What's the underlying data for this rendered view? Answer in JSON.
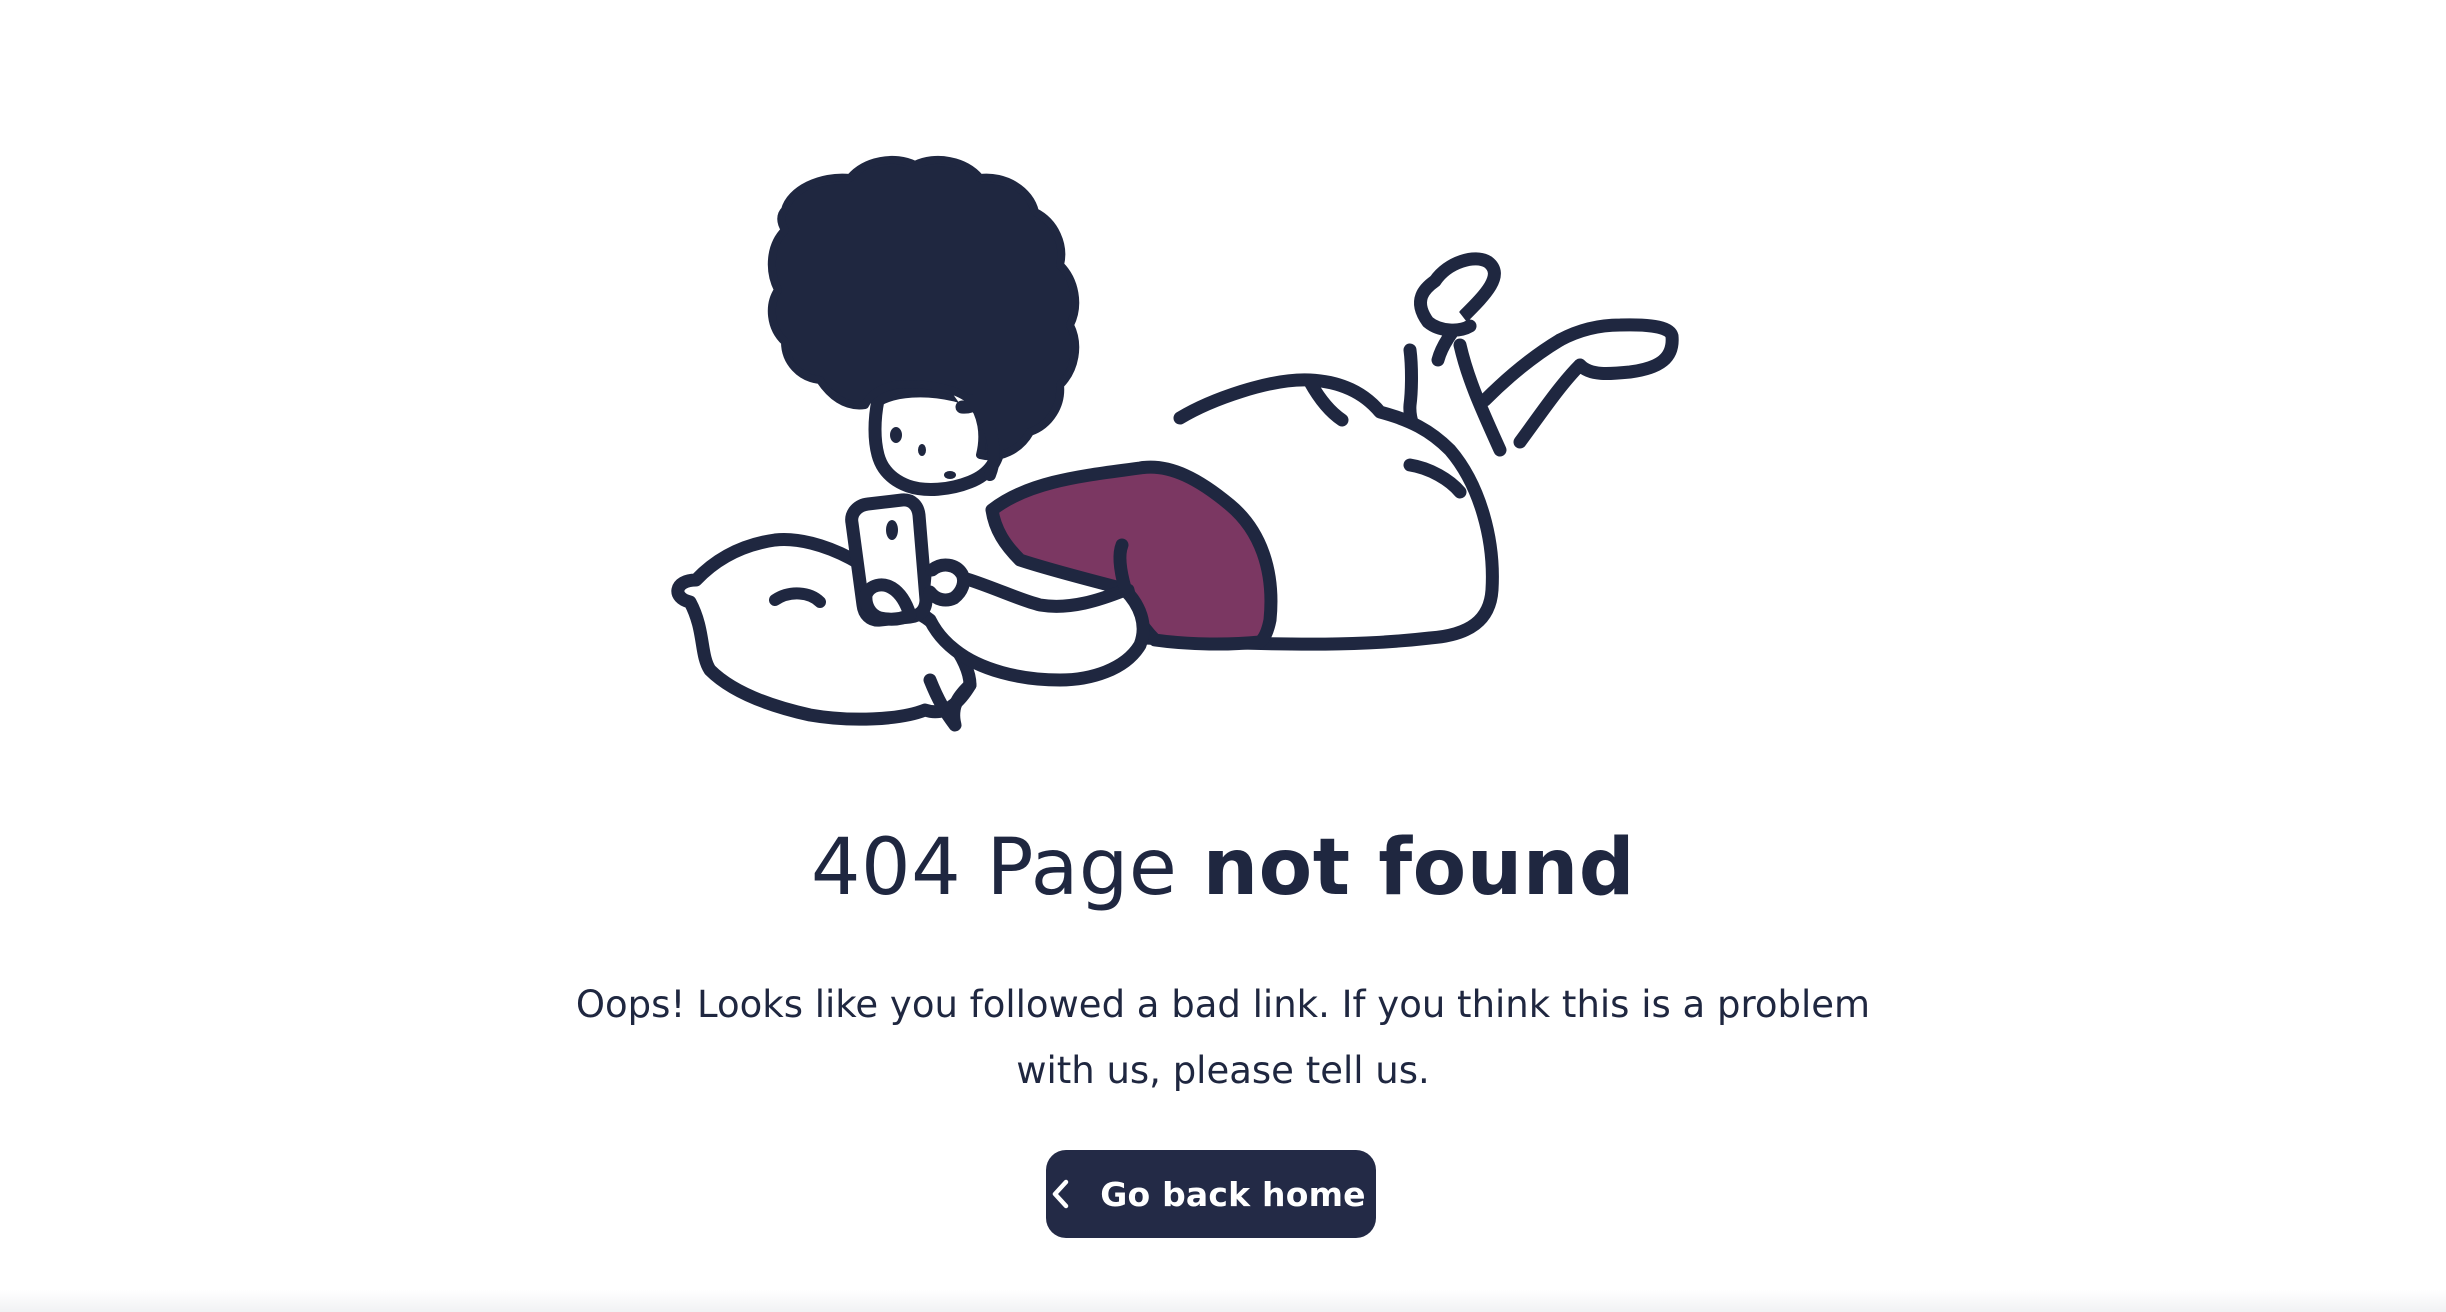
{
  "error": {
    "title_regular": "404 Page ",
    "title_bold": "not found",
    "description": "Oops! Looks like you followed a bad link. If you think this is a problem with us, please tell us."
  },
  "actions": {
    "home_button_label": "Go back home",
    "home_button_icon": "chevron-left-icon"
  },
  "illustration": {
    "subject": "person-lying-with-phone",
    "colors": {
      "ink": "#1f2740",
      "shirt": "#7b3762",
      "background": "#ffffff"
    }
  },
  "theme": {
    "text_color": "#1f2740",
    "button_background": "#232a46",
    "button_text": "#ffffff"
  }
}
